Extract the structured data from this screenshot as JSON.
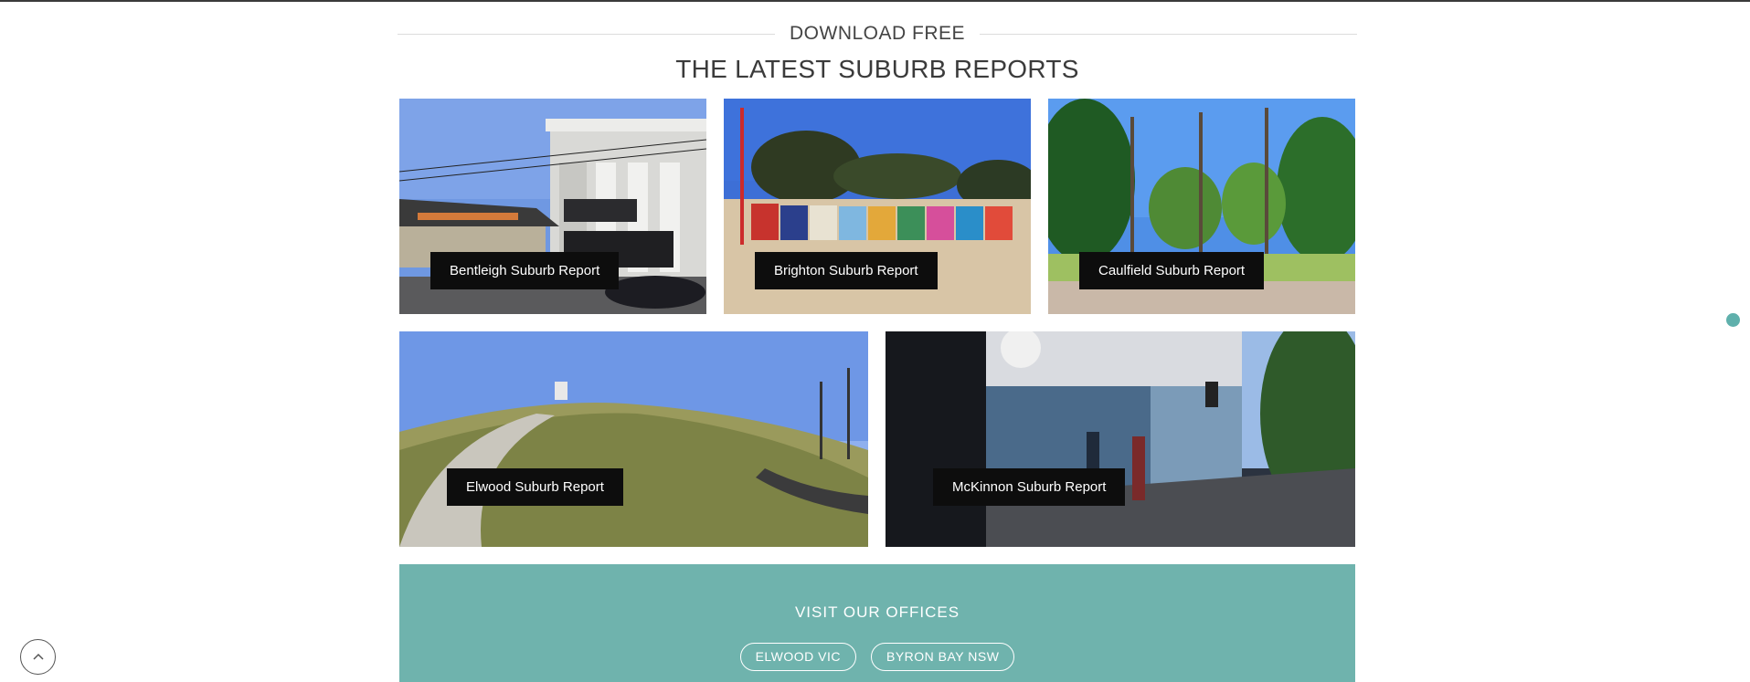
{
  "section": {
    "kicker": "DOWNLOAD FREE",
    "title": "THE LATEST SUBURB REPORTS"
  },
  "reports": [
    {
      "label": "Bentleigh Suburb Report"
    },
    {
      "label": "Brighton Suburb Report"
    },
    {
      "label": "Caulfield Suburb Report"
    },
    {
      "label": "Elwood Suburb Report"
    },
    {
      "label": "McKinnon Suburb Report"
    }
  ],
  "offices": {
    "heading": "VISIT OUR OFFICES",
    "buttons": [
      {
        "label": "ELWOOD VIC"
      },
      {
        "label": "BYRON BAY NSW"
      }
    ]
  },
  "icons": {
    "back_to_top": "chevron-up-icon",
    "floating_dot": "chat-dot-icon"
  },
  "colors": {
    "accent": "#6fb3ad",
    "label_bg": "#0d0d0d"
  }
}
